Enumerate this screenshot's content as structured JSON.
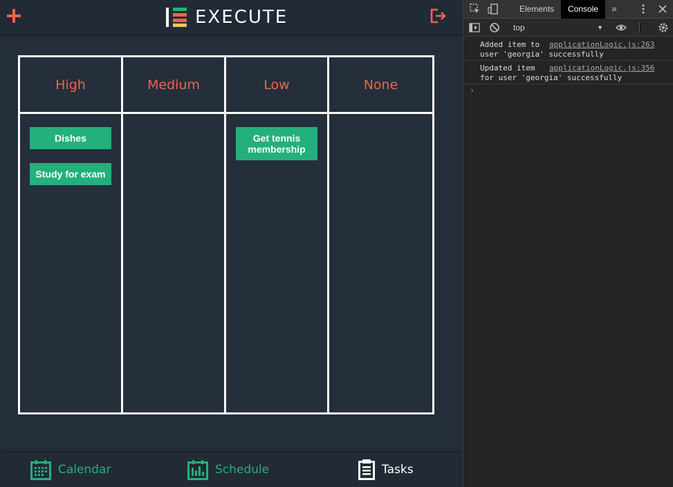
{
  "app": {
    "brand": "EXECUTE",
    "columns": [
      {
        "label": "High",
        "tasks": [
          "Dishes",
          "Study for exam"
        ]
      },
      {
        "label": "Medium",
        "tasks": []
      },
      {
        "label": "Low",
        "tasks": [
          "Get tennis membership"
        ]
      },
      {
        "label": "None",
        "tasks": []
      }
    ],
    "nav": {
      "calendar": "Calendar",
      "schedule": "Schedule",
      "tasks": "Tasks"
    },
    "icons": {
      "add": "plus-icon",
      "logout": "logout-icon",
      "logo": "execute-logo"
    },
    "colors": {
      "accent": "#f0634c",
      "task": "#23b07d",
      "bg": "#252e3b",
      "header": "#222a35"
    }
  },
  "devtools": {
    "tabs": {
      "elements": "Elements",
      "console": "Console",
      "more": "»"
    },
    "context": "top",
    "logs": [
      {
        "line1": "Added item to",
        "line2": "user 'georgia' successfully",
        "source": "applicationLogic.js:263"
      },
      {
        "line1": "Updated item",
        "line2": "for user 'georgia' successfully",
        "source": "applicationLogic.js:356"
      }
    ],
    "prompt": "›"
  }
}
